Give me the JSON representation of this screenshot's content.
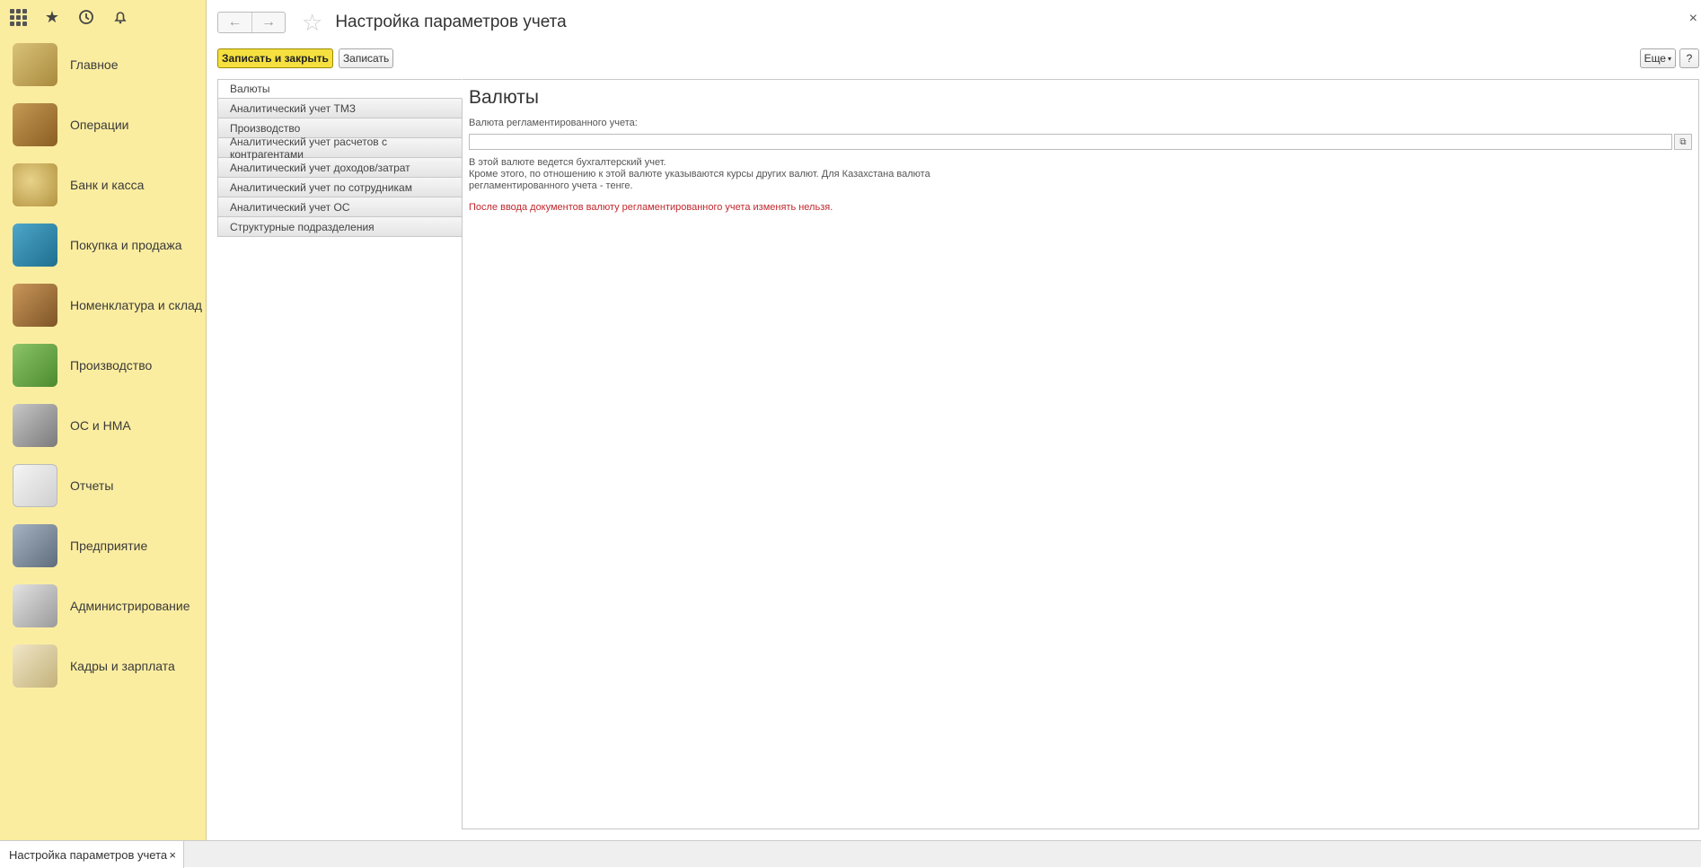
{
  "header": {
    "title": "Настройка параметров учета"
  },
  "sidebar": {
    "icons": [
      "apps-grid-icon",
      "star-icon",
      "history-icon",
      "bell-icon"
    ],
    "items": [
      {
        "label": "Главное"
      },
      {
        "label": "Операции"
      },
      {
        "label": "Банк и касса"
      },
      {
        "label": "Покупка и продажа"
      },
      {
        "label": "Номенклатура и склад"
      },
      {
        "label": "Производство"
      },
      {
        "label": "ОС и НМА"
      },
      {
        "label": "Отчеты"
      },
      {
        "label": "Предприятие"
      },
      {
        "label": "Администрирование"
      },
      {
        "label": "Кадры и зарплата"
      }
    ]
  },
  "toolbar": {
    "save_close": "Записать и закрыть",
    "save": "Записать",
    "more": "Еще",
    "help": "?"
  },
  "tabs": [
    {
      "label": "Валюты",
      "active": true
    },
    {
      "label": "Аналитический учет ТМЗ"
    },
    {
      "label": "Производство"
    },
    {
      "label": "Аналитический учет расчетов с контрагентами"
    },
    {
      "label": "Аналитический учет доходов/затрат"
    },
    {
      "label": "Аналитический учет по сотрудникам"
    },
    {
      "label": "Аналитический учет ОС"
    },
    {
      "label": "Структурные подразделения"
    }
  ],
  "panel": {
    "title": "Валюты",
    "field_label": "Валюта регламентированного учета:",
    "field_value": "",
    "info_line1": "В этой валюте ведется бухгалтерский учет.",
    "info_line2": "Кроме этого, по отношению к этой валюте указываются курсы других валют. Для Казахстана валюта регламентированного учета - тенге.",
    "warning": "После ввода документов валюту регламентированного учета изменять нельзя."
  },
  "taskbar": {
    "open_tab": "Настройка параметров учета",
    "close": "×"
  },
  "colors": {
    "sidebar_bg": "#fbeda0",
    "primary_button": "#f5e040",
    "warning_text": "#c1272d"
  }
}
